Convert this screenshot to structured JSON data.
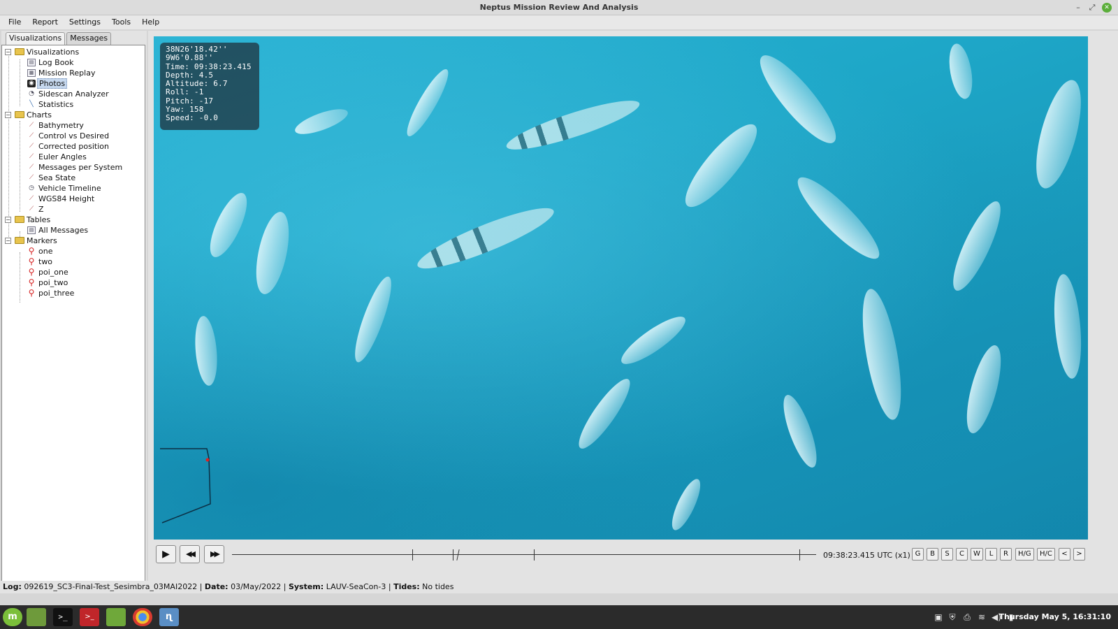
{
  "window": {
    "title": "Neptus Mission Review And Analysis",
    "controls": [
      "–",
      "⤢",
      "✕"
    ]
  },
  "menubar": [
    "File",
    "Report",
    "Settings",
    "Tools",
    "Help"
  ],
  "left_panel": {
    "tabs": [
      "Visualizations",
      "Messages"
    ],
    "tree": {
      "visualizations": {
        "label": "Visualizations",
        "items": [
          {
            "label": "Log Book",
            "icon": "book-icon"
          },
          {
            "label": "Mission Replay",
            "icon": "film-icon"
          },
          {
            "label": "Photos",
            "icon": "camera-icon",
            "selected": true
          },
          {
            "label": "Sidescan Analyzer",
            "icon": "sonar-icon"
          },
          {
            "label": "Statistics",
            "icon": "stats-icon"
          }
        ]
      },
      "charts": {
        "label": "Charts",
        "items": [
          "Bathymetry",
          "Control vs Desired",
          "Corrected position",
          "Euler Angles",
          "Messages per System",
          "Sea State",
          "Vehicle Timeline",
          "WGS84 Height",
          "Z"
        ]
      },
      "tables": {
        "label": "Tables",
        "items": [
          "All Messages"
        ]
      },
      "markers": {
        "label": "Markers",
        "items": [
          "one",
          "two",
          "poi_one",
          "poi_two",
          "poi_three"
        ]
      }
    }
  },
  "photo_overlay": {
    "lat": "38N26'18.42''",
    "lon": "9W6'0.88''",
    "time": "Time: 09:38:23.415",
    "depth": "Depth: 4.5",
    "altitude": "Altitude: 6.7",
    "roll": "Roll: -1",
    "pitch": "Pitch: -17",
    "yaw": "Yaw: 158",
    "speed": "Speed: -0.0"
  },
  "playback": {
    "play": "▶",
    "rewind": "◀◀",
    "forward": "▶▶",
    "time_label": "09:38:23.415 UTC (x1)",
    "filter_buttons": [
      "G",
      "B",
      "S",
      "C",
      "W",
      "L",
      "R",
      "H/G",
      "H/C",
      "<",
      ">"
    ]
  },
  "status": {
    "log_label": "Log:",
    "log_value": "092619_SC3-Final-Test_Sesimbra_03MAI2022",
    "date_label": "Date:",
    "date_value": "03/May/2022",
    "system_label": "System:",
    "system_value": "LAUV-SeaCon-3",
    "tides_label": "Tides:",
    "tides_value": "No tides",
    "sep": "|"
  },
  "taskbar": {
    "clock": "Thursday May  5, 16:31:10",
    "colors": {
      "bg": "#2b2b2b",
      "mint": "#7bbf3a",
      "red": "#c0262a"
    }
  }
}
